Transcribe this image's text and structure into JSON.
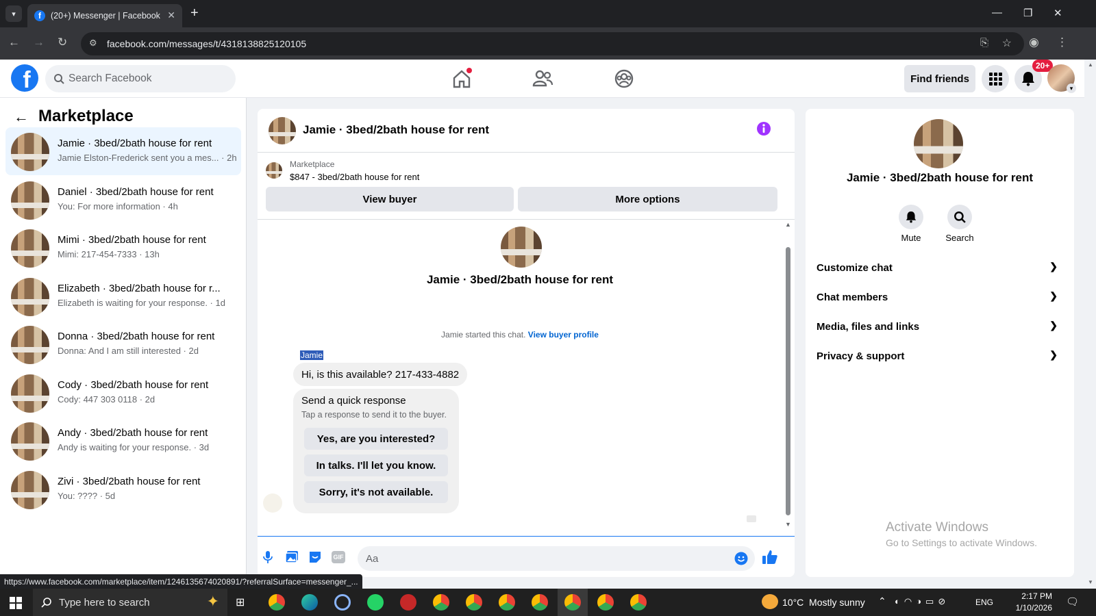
{
  "browser": {
    "tab_title": "(20+) Messenger | Facebook",
    "url": "facebook.com/messages/t/4318138825120105",
    "status_url": "https://www.facebook.com/marketplace/item/1246135674020891/?referralSurface=messenger_..."
  },
  "fb": {
    "search_placeholder": "Search Facebook",
    "find_friends": "Find friends",
    "notif_badge": "20+"
  },
  "sidebar": {
    "title": "Marketplace",
    "conversations": [
      {
        "name": "Jamie · 3bed/2bath house for rent",
        "snippet": "Jamie Elston-Frederick sent you a mes... · 2h"
      },
      {
        "name": "Daniel · 3bed/2bath house for rent",
        "snippet": "You: For more information · 4h"
      },
      {
        "name": "Mimi · 3bed/2bath house for rent",
        "snippet": "Mimi: 217-454-7333 · 13h"
      },
      {
        "name": "Elizabeth · 3bed/2bath house for r...",
        "snippet": "Elizabeth is waiting for your response. · 1d"
      },
      {
        "name": "Donna · 3bed/2bath house for rent",
        "snippet": "Donna: And I am still interested · 2d"
      },
      {
        "name": "Cody · 3bed/2bath house for rent",
        "snippet": "Cody: 447 303 0118 · 2d"
      },
      {
        "name": "Andy · 3bed/2bath house for rent",
        "snippet": "Andy is waiting for your response. · 3d"
      },
      {
        "name": "Zivi · 3bed/2bath house for rent",
        "snippet": "You: ???? · 5d"
      }
    ]
  },
  "chat": {
    "header_title": "Jamie · 3bed/2bath house for rent",
    "listing_label": "Marketplace",
    "listing_title": "$847 - 3bed/2bath house for rent",
    "view_buyer": "View buyer",
    "more_options": "More options",
    "intro_name": "Jamie · 3bed/2bath house for rent",
    "started_text": "Jamie started this chat.",
    "view_buyer_profile": "View buyer profile",
    "sender": "Jamie",
    "message": "Hi, is this available? 217-433-4882",
    "quick_title": "Send a quick response",
    "quick_sub": "Tap a response to send it to the buyer.",
    "quick_replies": [
      "Yes, are you interested?",
      "In talks. I'll let you know.",
      "Sorry, it's not available."
    ],
    "composer_placeholder": "Aa",
    "gif_label": "GIF"
  },
  "right": {
    "name": "Jamie · 3bed/2bath house for rent",
    "mute": "Mute",
    "search": "Search",
    "sections": [
      "Customize chat",
      "Chat members",
      "Media, files and links",
      "Privacy & support"
    ],
    "activate_title": "Activate Windows",
    "activate_sub": "Go to Settings to activate Windows."
  },
  "taskbar": {
    "search_placeholder": "Type here to search",
    "weather": "10°C  Mostly sunny",
    "lang": "ENG",
    "time": "2:17 PM",
    "date": "1/10/2026"
  },
  "colors": {
    "fb_blue": "#1877f2",
    "messenger_purple": "#a033ff",
    "badge_red": "#e41e3f"
  }
}
